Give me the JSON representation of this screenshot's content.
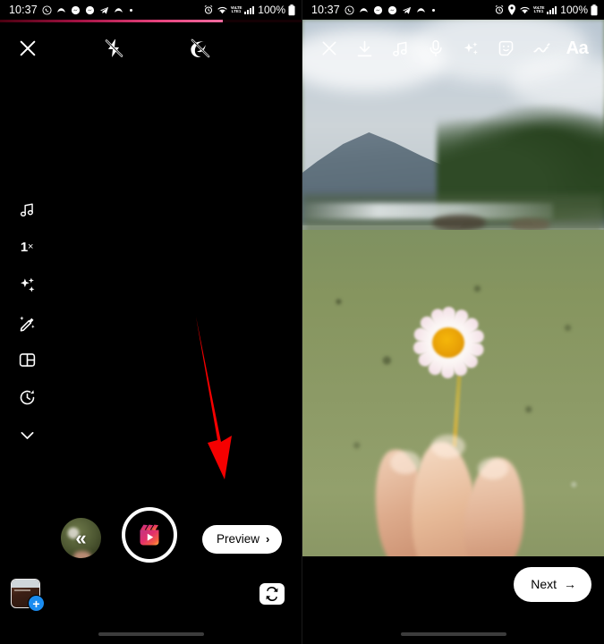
{
  "status_bar": {
    "time": "10:37",
    "battery": "100%",
    "network_label": "VoLTE",
    "left_icons": [
      "whatsapp-icon",
      "instagram-icon",
      "messenger-icon",
      "messenger-icon",
      "telegram-icon",
      "instagram-icon",
      "more-dot-icon"
    ],
    "right_icons_left": [
      "alarm-icon",
      "location-icon",
      "wifi-icon",
      "volte-icon",
      "signal-bars-icon",
      "battery-icon"
    ]
  },
  "left_phone": {
    "progress": {
      "percent": 74,
      "gradient_from": "#4a0010",
      "gradient_to": "#f06ca0"
    },
    "toolbar": [
      {
        "name": "close-icon",
        "label": "Close"
      },
      {
        "name": "flash-off-icon",
        "label": "Flash off"
      },
      {
        "name": "sound-off-icon",
        "label": "Sound off"
      }
    ],
    "side_tools": [
      {
        "name": "music-icon",
        "label": "Audio"
      },
      {
        "name": "speed-icon",
        "label": "1",
        "suffix": "×"
      },
      {
        "name": "effects-icon",
        "label": "Effects"
      },
      {
        "name": "retouch-icon",
        "label": "Retouch"
      },
      {
        "name": "layout-icon",
        "label": "Layout"
      },
      {
        "name": "timer-icon",
        "label": "Timer"
      },
      {
        "name": "chevron-down-icon",
        "label": "More"
      }
    ],
    "controls": {
      "back_clip_label": "«",
      "record_button": "reels-record-button",
      "preview_label": "Preview",
      "preview_arrow": "›"
    },
    "bottom": {
      "gallery_label": "gallery-thumbnail",
      "add_badge": "+",
      "flip_camera_label": "flip-camera-icon"
    }
  },
  "right_phone": {
    "toolbar": [
      {
        "name": "close-icon",
        "label": "Close"
      },
      {
        "name": "download-icon",
        "label": "Save"
      },
      {
        "name": "music-icon",
        "label": "Music"
      },
      {
        "name": "microphone-icon",
        "label": "Voiceover"
      },
      {
        "name": "effects-icon",
        "label": "Effects"
      },
      {
        "name": "sticker-icon",
        "label": "Sticker"
      },
      {
        "name": "draw-icon",
        "label": "Draw"
      },
      {
        "name": "text-icon",
        "label": "Aa"
      }
    ],
    "next_label": "Next",
    "next_arrow": "→",
    "photo_description": "Blurred outdoor scene: hand holding a white daisy with yellow center over a green field, mountains and trees in background"
  },
  "annotations": [
    {
      "name": "arrow-to-preview",
      "color": "#f50000",
      "direction": "down-right",
      "points_at": "Preview"
    },
    {
      "name": "arrow-to-music",
      "color": "#f50000",
      "direction": "up",
      "points_at": "music-icon"
    }
  ]
}
